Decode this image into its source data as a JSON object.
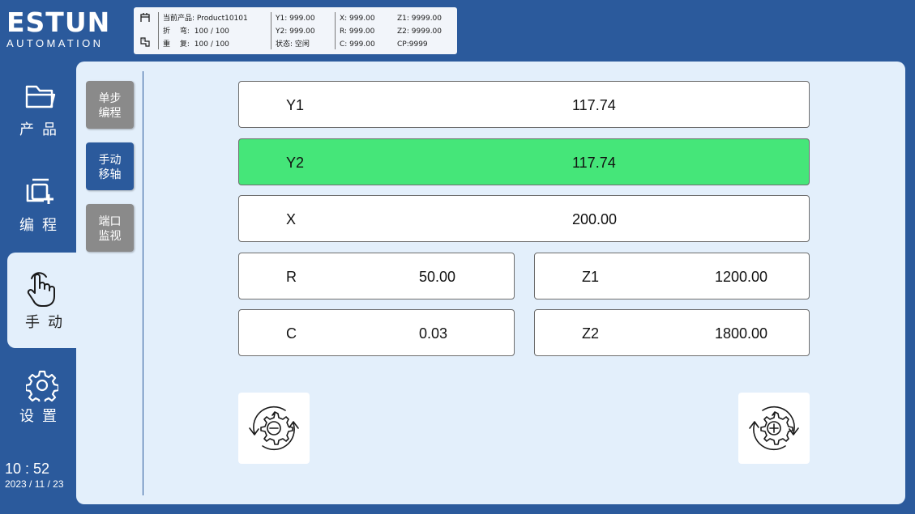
{
  "brand": {
    "wordmark": "ESTUN",
    "tagline": "AUTOMATION"
  },
  "info": {
    "current_product_label": "当前产品:",
    "current_product": "Product10101",
    "bend_label": "折　 弯:",
    "bend_value": "100 / 100",
    "repeat_label": "重　 复:",
    "repeat_value": "100 / 100",
    "y1": "Y1:  999.00",
    "y2": "Y2:  999.00",
    "status": "状态: 空闲",
    "x": "X:  999.00",
    "r": "R:  999.00",
    "c": "C:  999.00",
    "z1": "Z1: 9999.00",
    "z2": "Z2: 9999.00",
    "cp": "CP:9999"
  },
  "sidebar": {
    "items": [
      {
        "label": "产品",
        "icon": "folder-icon"
      },
      {
        "label": "编程",
        "icon": "add-copy-icon"
      },
      {
        "label": "手动",
        "icon": "hand-pointer-icon",
        "active": true
      },
      {
        "label": "设置",
        "icon": "gear-icon"
      }
    ]
  },
  "clock": {
    "time": "10 : 52",
    "date": "2023 / 11 / 23"
  },
  "subtabs": [
    {
      "label": "单步编程",
      "state": "gray"
    },
    {
      "label": "手动移轴",
      "state": "active"
    },
    {
      "label": "端口监视",
      "state": "gray"
    }
  ],
  "axes": {
    "y1": {
      "name": "Y1",
      "value": "117.74"
    },
    "y2": {
      "name": "Y2",
      "value": "117.74",
      "selected": true
    },
    "x": {
      "name": "X",
      "value": "200.00"
    },
    "r": {
      "name": "R",
      "value": "50.00"
    },
    "z1": {
      "name": "Z1",
      "value": "1200.00"
    },
    "c": {
      "name": "C",
      "value": "0.03"
    },
    "z2": {
      "name": "Z2",
      "value": "1800.00"
    }
  },
  "colors": {
    "background": "#2b5a9c",
    "panel": "#e3effb",
    "selected": "#45e679",
    "subtab_gray": "#8a8a8a"
  }
}
